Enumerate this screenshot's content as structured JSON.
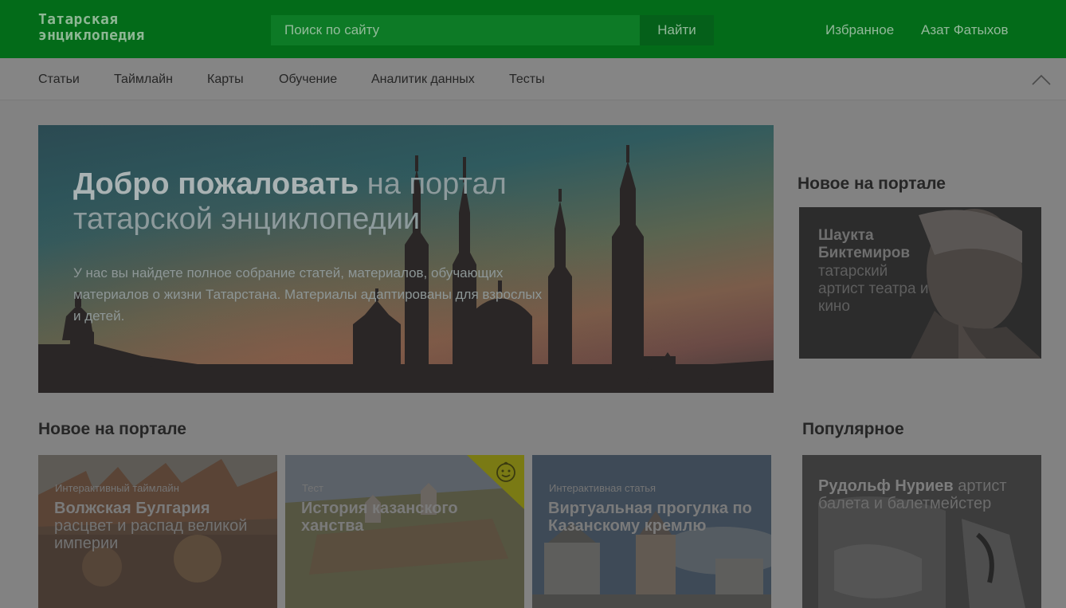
{
  "header": {
    "logo_line1": "Татарская",
    "logo_line2": "энциклопедия",
    "search_placeholder": "Поиск по сайту",
    "search_button": "Найти",
    "favorites": "Избранное",
    "user_name": "Азат Фатыхов"
  },
  "nav": {
    "items": [
      "Статьи",
      "Таймлайн",
      "Карты",
      "Обучение",
      "Аналитик данных",
      "Тесты"
    ]
  },
  "hero": {
    "title_bold": "Добро пожаловать",
    "title_rest": " на портал татарской энциклопедии",
    "text": "У нас вы найдете полное собрание статей, материалов, обучающих материалов о жизни Татарстана. Материалы адаптированы для взрослых и детей."
  },
  "side_new": {
    "heading": "Новое на портале",
    "name": "Шаукта Биктемиров",
    "desc": "татарский артист театра и кино"
  },
  "new_section": {
    "heading": "Новое на портале",
    "cards": [
      {
        "type": "Интерактивный таймлайн",
        "title": "Волжская Булгария",
        "subtitle": "расцвет и распад великой империи"
      },
      {
        "type": "Тест",
        "title": "История казанского ханства",
        "subtitle": ""
      },
      {
        "type": "Интерактивная статья",
        "title": "Виртуальная прогулка по Казанскому кремлю",
        "subtitle": ""
      }
    ]
  },
  "popular": {
    "heading": "Популярное",
    "name": "Рудольф Нуриев",
    "desc": " артист балета и балетмейстер"
  }
}
